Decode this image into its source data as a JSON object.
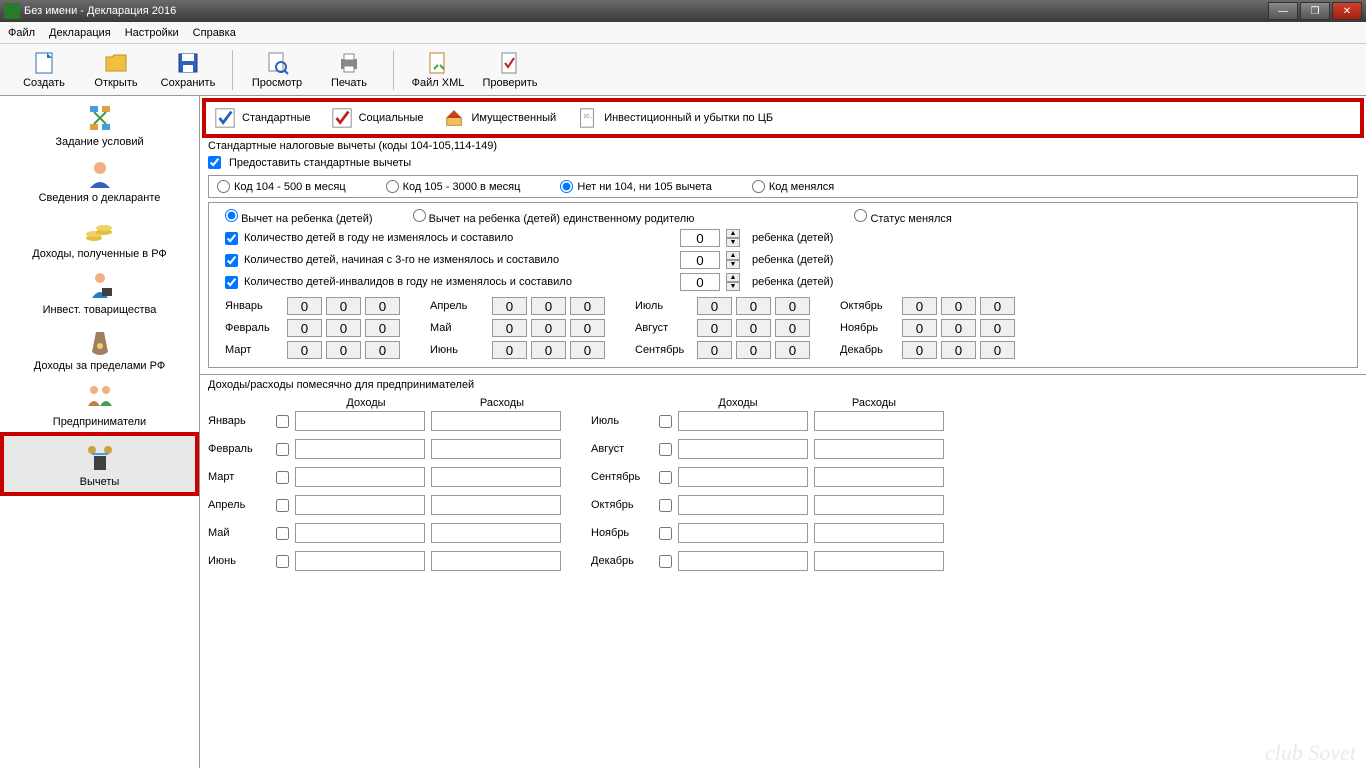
{
  "window": {
    "title": "Без имени - Декларация 2016"
  },
  "menu": {
    "file": "Файл",
    "decl": "Декларация",
    "settings": "Настройки",
    "help": "Справка"
  },
  "toolbar": {
    "create": "Создать",
    "open": "Открыть",
    "save": "Сохранить",
    "preview": "Просмотр",
    "print": "Печать",
    "xml": "Файл XML",
    "check": "Проверить"
  },
  "sidebar": [
    {
      "label": "Задание условий"
    },
    {
      "label": "Сведения о декларанте"
    },
    {
      "label": "Доходы, полученные в РФ"
    },
    {
      "label": "Инвест. товарищества"
    },
    {
      "label": "Доходы за пределами РФ"
    },
    {
      "label": "Предприниматели"
    },
    {
      "label": "Вычеты"
    }
  ],
  "tabs": [
    {
      "label": "Стандартные"
    },
    {
      "label": "Социальные"
    },
    {
      "label": "Имущественный"
    },
    {
      "label": "Инвестиционный и убытки по ЦБ"
    }
  ],
  "section": {
    "title": "Стандартные налоговые вычеты (коды 104-105,114-149)",
    "provide": "Предоставить стандартные вычеты"
  },
  "radios1": {
    "r1": "Код 104 - 500 в месяц",
    "r2": "Код 105 - 3000 в месяц",
    "r3": "Нет ни 104, ни 105 вычета",
    "r4": "Код менялся"
  },
  "radios2": {
    "r1": "Вычет на ребенка (детей)",
    "r2": "Вычет на ребенка (детей) единственному родителю",
    "r3": "Статус менялся"
  },
  "children": {
    "c1": "Количество детей в году не изменялось и составило",
    "c2": "Количество детей, начиная с 3-го не изменялось и составило",
    "c3": "Количество детей-инвалидов в году не изменялось и составило",
    "val1": "0",
    "val2": "0",
    "val3": "0",
    "suffix": "ребенка (детей)"
  },
  "months": [
    "Январь",
    "Февраль",
    "Март",
    "Апрель",
    "Май",
    "Июнь",
    "Июль",
    "Август",
    "Сентябрь",
    "Октябрь",
    "Ноябрь",
    "Декабрь"
  ],
  "monthval": "0",
  "section2": {
    "title": "Доходы/расходы помесячно для предпринимателей",
    "income": "Доходы",
    "expense": "Расходы"
  },
  "watermark": "club Sovet"
}
